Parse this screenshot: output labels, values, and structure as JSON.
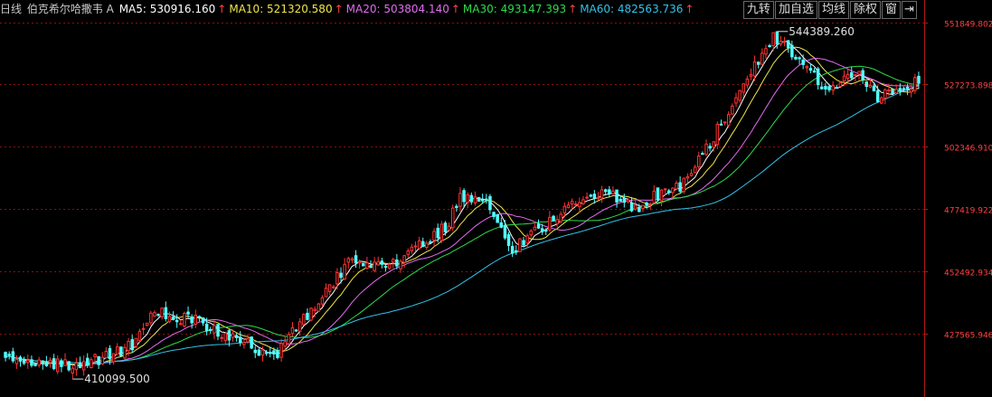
{
  "header": {
    "period": "日线",
    "name": "伯克希尔哈撒韦 A",
    "ma": [
      {
        "label": "MA5: 530916.160",
        "color": "#ffffff"
      },
      {
        "label": "MA10: 521320.580",
        "color": "#f0e44a"
      },
      {
        "label": "MA20: 503804.140",
        "color": "#e36cf0"
      },
      {
        "label": "MA30: 493147.393",
        "color": "#2cdc4a"
      },
      {
        "label": "MA60: 482563.736",
        "color": "#31c3e8"
      }
    ],
    "arrow": "↑",
    "arrow_color": "#ff4444"
  },
  "buttons": [
    "九转",
    "加自选",
    "均线",
    "除权",
    "窗"
  ],
  "arrow_button": "⇥",
  "chart_data": {
    "type": "candlestick",
    "y_ticks": [
      "551849.802",
      "527273.898",
      "502346.910",
      "477419.922",
      "452492.934",
      "427565.946"
    ],
    "y_tick_values": [
      551849.802,
      527273.898,
      502346.91,
      477419.922,
      452492.934,
      427565.946
    ],
    "ylim": [
      403000,
      553500
    ],
    "annotations": [
      {
        "text": "544389.260",
        "value": 544389.26,
        "kind": "max"
      },
      {
        "text": "410099.500",
        "value": 410099.5,
        "kind": "min"
      }
    ],
    "anchors": [
      [
        0,
        418000
      ],
      [
        12,
        415000
      ],
      [
        20,
        414500
      ],
      [
        34,
        423000
      ],
      [
        40,
        437000
      ],
      [
        52,
        432000
      ],
      [
        62,
        425000
      ],
      [
        72,
        418000
      ],
      [
        78,
        430000
      ],
      [
        92,
        455000
      ],
      [
        105,
        456000
      ],
      [
        118,
        470000
      ],
      [
        122,
        482000
      ],
      [
        128,
        482000
      ],
      [
        136,
        461000
      ],
      [
        146,
        472500
      ],
      [
        152,
        478000
      ],
      [
        160,
        484500
      ],
      [
        170,
        476000
      ],
      [
        176,
        485000
      ],
      [
        182,
        487000
      ],
      [
        192,
        511000
      ],
      [
        200,
        531000
      ],
      [
        206,
        547000
      ],
      [
        212,
        537000
      ],
      [
        220,
        525000
      ],
      [
        228,
        533000
      ],
      [
        234,
        521000
      ],
      [
        240,
        526000
      ],
      [
        245,
        527500
      ]
    ],
    "colors": {
      "up": "#ff3232",
      "down": "#54ffff",
      "grid": "#8a1010"
    }
  }
}
